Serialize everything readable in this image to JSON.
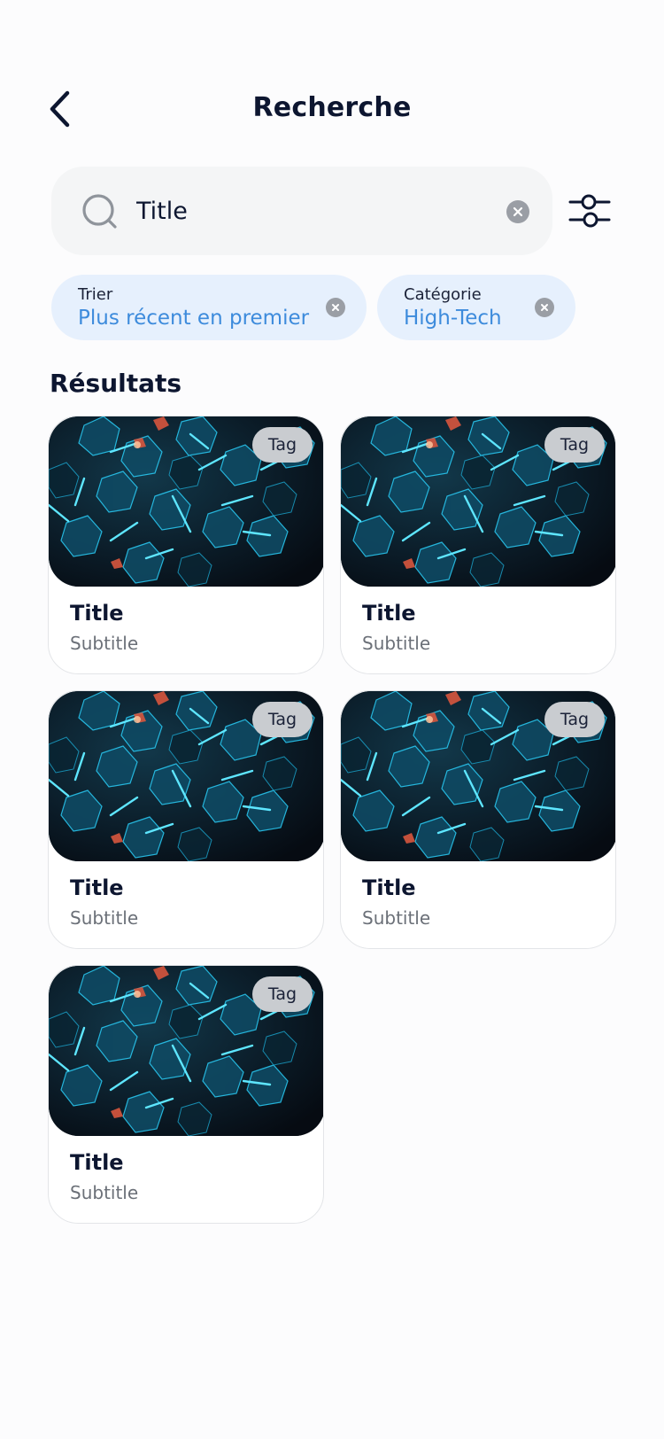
{
  "header": {
    "title": "Recherche",
    "back_icon": "chevron-left-icon"
  },
  "search": {
    "value": "Title",
    "placeholder": "",
    "icon": "search-icon",
    "clear_icon": "close-circle-icon"
  },
  "filter_button": {
    "icon": "sliders-icon"
  },
  "chips": [
    {
      "label": "Trier",
      "value": "Plus récent en premier",
      "clear_icon": "close-circle-icon"
    },
    {
      "label": "Catégorie",
      "value": "High-Tech",
      "clear_icon": "close-circle-icon"
    }
  ],
  "results": {
    "title": "Résultats",
    "items": [
      {
        "tag": "Tag",
        "title": "Title",
        "subtitle": "Subtitle"
      },
      {
        "tag": "Tag",
        "title": "Title",
        "subtitle": "Subtitle"
      },
      {
        "tag": "Tag",
        "title": "Title",
        "subtitle": "Subtitle"
      },
      {
        "tag": "Tag",
        "title": "Title",
        "subtitle": "Subtitle"
      },
      {
        "tag": "Tag",
        "title": "Title",
        "subtitle": "Subtitle"
      }
    ]
  },
  "colors": {
    "primary_text": "#0d1630",
    "accent": "#3d8bdc",
    "chip_background": "#e6f0fd",
    "search_background": "#f4f5f6"
  }
}
